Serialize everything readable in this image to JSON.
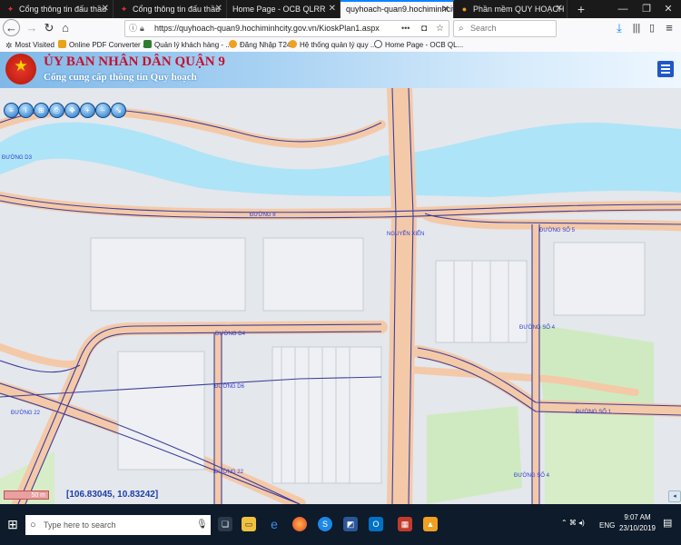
{
  "browser": {
    "tabs": [
      {
        "label": "Cổng thông tin đấu thầu",
        "active": false
      },
      {
        "label": "Cổng thông tin đấu thầu",
        "active": false
      },
      {
        "label": "Home Page - OCB QLRR",
        "active": false
      },
      {
        "label": "quyhoach-quan9.hochiminhcity",
        "active": true
      },
      {
        "label": "Phần mềm QUY HOẠCH QU",
        "active": false
      }
    ],
    "new_tab": "+",
    "url": "https://quyhoach-quan9.hochiminhcity.gov.vn/KioskPlan1.aspx",
    "url_menu": "•••",
    "search_placeholder": "Search",
    "bookmarks": [
      {
        "label": "Most Visited",
        "color": "#444444"
      },
      {
        "label": "Online PDF Converter ...",
        "color": "#e8a317"
      },
      {
        "label": "Quản lý khách hàng - ...",
        "color": "#2e7d32"
      },
      {
        "label": "Đăng Nhập T24",
        "color": "#f0a020"
      },
      {
        "label": "Hệ thống quản lý quy ...",
        "color": "#f0a020"
      },
      {
        "label": "Home Page - OCB QL...",
        "color": "#555555"
      }
    ]
  },
  "header": {
    "title": "ỦY BAN NHÂN DÂN QUẬN 9",
    "subtitle": "Cổng cung cấp thông tin Quy hoạch"
  },
  "map": {
    "street_labels": {
      "d8": "ĐƯỜNG 8",
      "nguyen_xien": "NGUYỄN XIỂN",
      "so5": "ĐƯỜNG SỐ 5",
      "so4_a": "ĐƯỜNG SỐ 4",
      "d4": "ĐƯỜNG D4",
      "d6": "ĐƯỜNG D6",
      "d22_left": "ĐƯỜNG 22",
      "d22_bottom": "ĐƯỜNG 22",
      "so1": "ĐƯỜNG SỐ 1",
      "so4_b": "ĐƯỜNG SỐ 4",
      "d3": "ĐƯỜNG D3"
    },
    "scale": "50 m",
    "coordinates": "[106.83045, 10.83242]",
    "colors": {
      "river": "#aee4f7",
      "road_casing": "#f4c9a8",
      "road_line": "#3d3f9b",
      "park": "#cfeac0",
      "block": "#e3e6ec"
    }
  },
  "taskbar": {
    "search_placeholder": "Type here to search",
    "time": "9:07 AM",
    "date": "23/10/2019",
    "lang": "ENG"
  }
}
